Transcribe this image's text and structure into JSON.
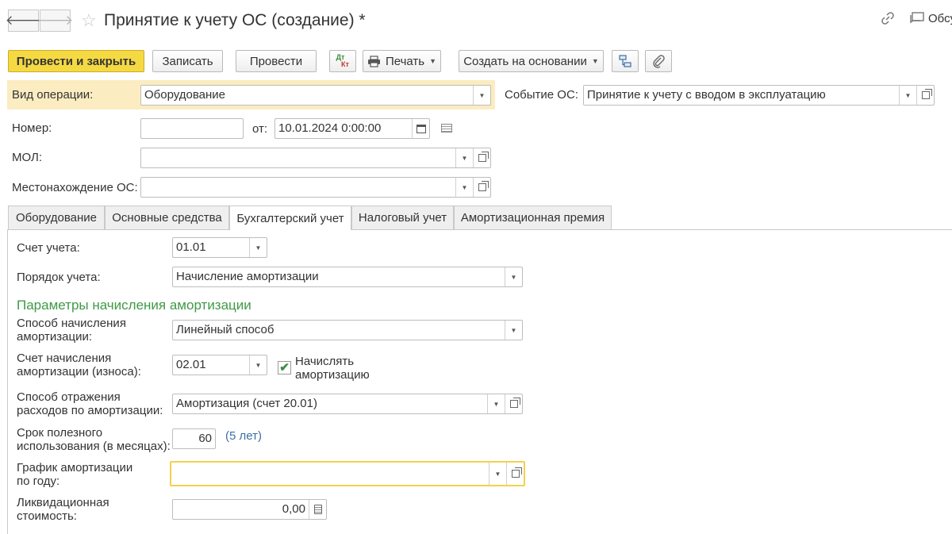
{
  "header": {
    "title": "Принятие к учету ОС (создание) *",
    "discuss_label": "Обсу"
  },
  "toolbar": {
    "post_close": "Провести и закрыть",
    "save": "Записать",
    "post": "Провести",
    "dt_kt_top": "Дт",
    "dt_kt_bottom": "Кт",
    "print": "Печать",
    "create_based": "Создать на основании"
  },
  "form": {
    "op_type_label": "Вид операции:",
    "op_type_value": "Оборудование",
    "event_label": "Событие ОС:",
    "event_value": "Принятие к учету с вводом в эксплуатацию",
    "number_label": "Номер:",
    "number_value": "",
    "from_label": "от:",
    "date_value": "10.01.2024  0:00:00",
    "mol_label": "МОЛ:",
    "mol_value": "",
    "location_label": "Местонахождение ОС:",
    "location_value": ""
  },
  "tabs": [
    {
      "label": "Оборудование"
    },
    {
      "label": "Основные средства"
    },
    {
      "label": "Бухгалтерский учет"
    },
    {
      "label": "Налоговый учет"
    },
    {
      "label": "Амортизационная премия"
    }
  ],
  "accounting": {
    "account_label": "Счет учета:",
    "account_value": "01.01",
    "order_label": "Порядок учета:",
    "order_value": "Начисление амортизации",
    "section_title": "Параметры начисления амортизации",
    "method_label_1": "Способ начисления",
    "method_label_2": "амортизации:",
    "method_value": "Линейный способ",
    "dep_account_label_1": "Счет начисления",
    "dep_account_label_2": "амортизации (износа):",
    "dep_account_value": "02.01",
    "accrue_label_1": "Начислять",
    "accrue_label_2": "амортизацию",
    "accrue_checked": true,
    "expense_label_1": "Способ отражения",
    "expense_label_2": "расходов по амортизации:",
    "expense_value": "Амортизация (счет 20.01)",
    "life_label_1": "Срок полезного",
    "life_label_2": "использования (в месяцах):",
    "life_value": "60",
    "life_years": "(5 лет)",
    "schedule_label_1": "График амортизации",
    "schedule_label_2": "по году:",
    "schedule_value": "",
    "salvage_label_1": "Ликвидационная",
    "salvage_label_2": "стоимость:",
    "salvage_value": "0,00"
  },
  "colors": {
    "primary_button": "#f5d943",
    "highlight_band": "#fbecc1",
    "section_title": "#3f9a46",
    "link": "#3d6fa7",
    "focus_border": "#f3d150"
  },
  "icons": {
    "back": "arrow-left-icon",
    "forward": "arrow-right-icon",
    "favorite": "star-icon",
    "link": "link-icon",
    "discuss": "chat-icon",
    "print": "printer-icon",
    "structure": "structure-icon",
    "attach": "paperclip-icon"
  }
}
